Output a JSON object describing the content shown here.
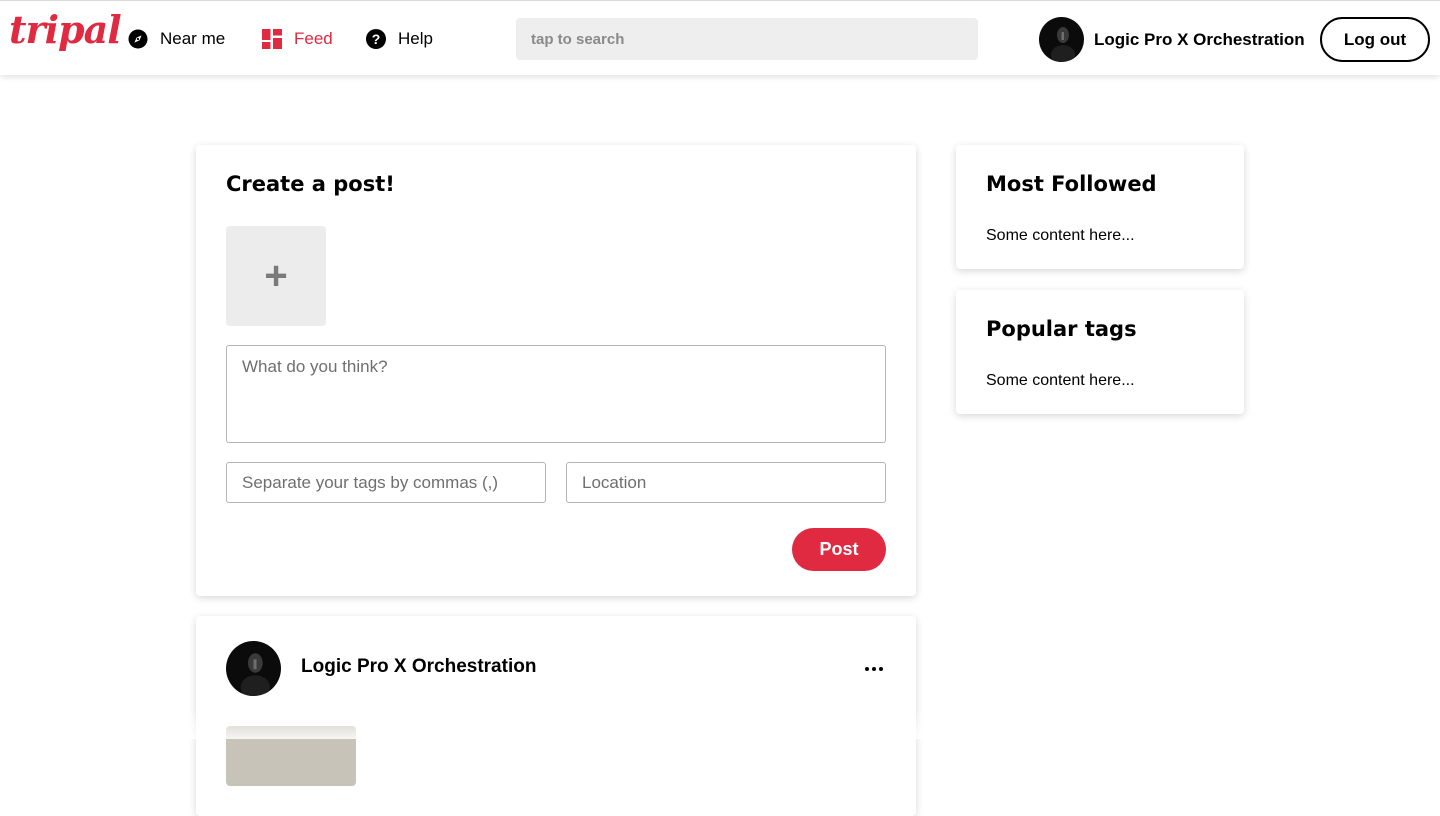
{
  "brand": {
    "logo_text": "tripal",
    "accent_color": "#e02a41"
  },
  "nav": {
    "near_me": {
      "label": "Near me",
      "icon": "compass-icon"
    },
    "feed": {
      "label": "Feed",
      "icon": "dashboard-icon",
      "active": true
    },
    "help": {
      "label": "Help",
      "icon": "help-circle-icon"
    }
  },
  "search": {
    "placeholder": "tap to search",
    "value": ""
  },
  "user": {
    "name": "Logic Pro X Orchestration",
    "logout_label": "Log out"
  },
  "create_post": {
    "title": "Create a post!",
    "add_photo_symbol": "+",
    "text_placeholder": "What do you think?",
    "tags_placeholder": "Separate your tags by commas (,)",
    "location_placeholder": "Location",
    "post_label": "Post"
  },
  "feed_post": {
    "author": "Logic Pro X Orchestration",
    "menu_icon": "more-horizontal-icon"
  },
  "sidebar": {
    "most_followed": {
      "title": "Most Followed",
      "body": "Some content here..."
    },
    "popular_tags": {
      "title": "Popular tags",
      "body": "Some content here..."
    }
  }
}
